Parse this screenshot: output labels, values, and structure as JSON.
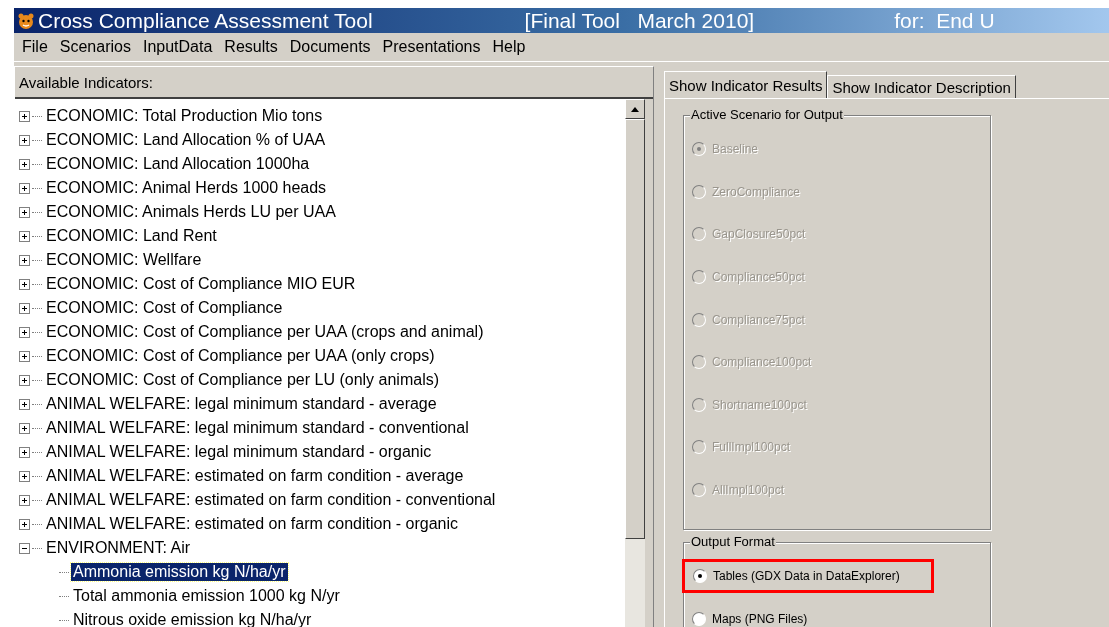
{
  "window": {
    "title": "Cross Compliance Assessment Tool",
    "version": "[Final Tool   March 2010]",
    "audience": "for:  End U"
  },
  "menu": [
    "File",
    "Scenarios",
    "InputData",
    "Results",
    "Documents",
    "Presentations",
    "Help"
  ],
  "indicators": {
    "label": "Available Indicators:",
    "items": [
      {
        "label": "ECONOMIC: Total Production Mio tons",
        "expanded": false
      },
      {
        "label": "ECONOMIC: Land Allocation % of UAA",
        "expanded": false
      },
      {
        "label": "ECONOMIC: Land Allocation 1000ha",
        "expanded": false
      },
      {
        "label": "ECONOMIC: Animal Herds 1000 heads",
        "expanded": false
      },
      {
        "label": "ECONOMIC: Animals Herds LU per UAA",
        "expanded": false
      },
      {
        "label": "ECONOMIC: Land Rent",
        "expanded": false
      },
      {
        "label": "ECONOMIC: Wellfare",
        "expanded": false
      },
      {
        "label": "ECONOMIC: Cost of Compliance MIO EUR",
        "expanded": false
      },
      {
        "label": "ECONOMIC: Cost of Compliance",
        "expanded": false
      },
      {
        "label": "ECONOMIC: Cost of Compliance per UAA (crops and animal)",
        "expanded": false
      },
      {
        "label": "ECONOMIC: Cost of Compliance per UAA (only crops)",
        "expanded": false
      },
      {
        "label": "ECONOMIC: Cost of Compliance per LU (only animals)",
        "expanded": false
      },
      {
        "label": "ANIMAL WELFARE: legal minimum standard - average",
        "expanded": false
      },
      {
        "label": "ANIMAL WELFARE: legal minimum standard - conventional",
        "expanded": false
      },
      {
        "label": "ANIMAL WELFARE: legal minimum standard - organic",
        "expanded": false
      },
      {
        "label": "ANIMAL WELFARE: estimated on farm condition - average",
        "expanded": false
      },
      {
        "label": "ANIMAL WELFARE: estimated on farm condition - conventional",
        "expanded": false
      },
      {
        "label": "ANIMAL WELFARE: estimated on farm condition - organic",
        "expanded": false
      },
      {
        "label": "ENVIRONMENT: Air",
        "expanded": true,
        "children": [
          {
            "label": "Ammonia emission kg N/ha/yr",
            "selected": true
          },
          {
            "label": "Total ammonia emission 1000 kg N/yr",
            "selected": false
          },
          {
            "label": "Nitrous oxide emission kg N/ha/yr",
            "selected": false
          }
        ]
      }
    ]
  },
  "tabs": [
    {
      "label": "Show Indicator Results",
      "selected": true
    },
    {
      "label": "Show Indicator Description",
      "selected": false
    }
  ],
  "scenario_group": {
    "title": "Active Scenario for Output",
    "options": [
      {
        "label": "Baseline",
        "selected": true,
        "disabled": true
      },
      {
        "label": "ZeroCompliance",
        "selected": false,
        "disabled": true
      },
      {
        "label": "GapClosure50pct",
        "selected": false,
        "disabled": true
      },
      {
        "label": "Compliance50pct",
        "selected": false,
        "disabled": true
      },
      {
        "label": "Compliance75pct",
        "selected": false,
        "disabled": true
      },
      {
        "label": "Compliance100pct",
        "selected": false,
        "disabled": true
      },
      {
        "label": "Shortname100pct",
        "selected": false,
        "disabled": true
      },
      {
        "label": "FullImpl100pct",
        "selected": false,
        "disabled": true
      },
      {
        "label": "AllImpl100pct",
        "selected": false,
        "disabled": true
      }
    ]
  },
  "output_group": {
    "title": "Output Format",
    "options": [
      {
        "label": "Tables (GDX Data in DataExplorer)",
        "selected": true,
        "disabled": false,
        "highlighted": true
      },
      {
        "label": "Maps (PNG Files)",
        "selected": false,
        "disabled": false,
        "highlighted": false
      }
    ]
  }
}
